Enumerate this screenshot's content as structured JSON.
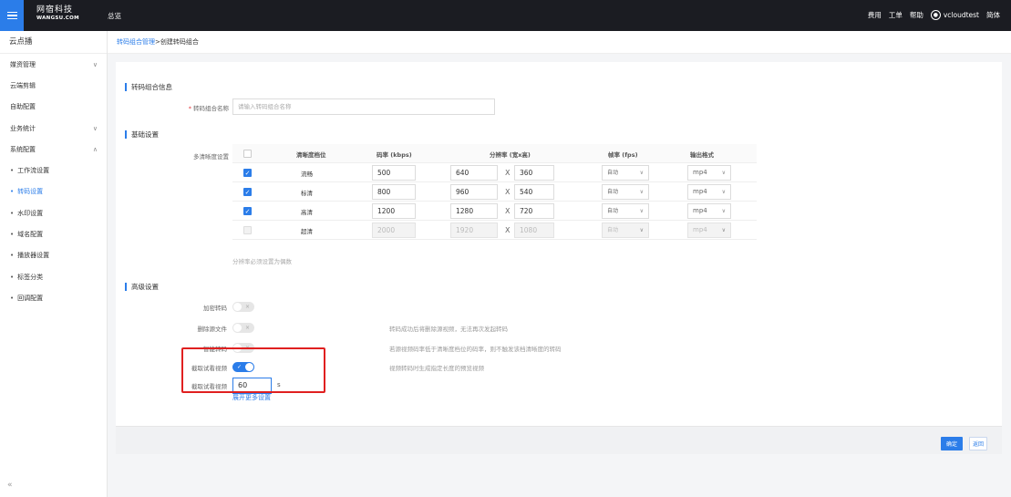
{
  "header": {
    "logo_cn": "网宿科技",
    "logo_en": "WANGSU.COM",
    "overview": "总览",
    "links": [
      "费用",
      "工单",
      "帮助"
    ],
    "username": "vcloudtest",
    "lang": "简体"
  },
  "sidebar": {
    "title": "云点播",
    "items": [
      {
        "label": "媒资管理",
        "chevron": "down"
      },
      {
        "label": "云端剪辑"
      },
      {
        "label": "自助配置"
      },
      {
        "label": "业务统计",
        "chevron": "down"
      },
      {
        "label": "系统配置",
        "chevron": "up"
      }
    ],
    "subitems": [
      "工作流设置",
      "转码设置",
      "水印设置",
      "域名配置",
      "播放器设置",
      "标签分类",
      "回调配置"
    ],
    "active_sub": "转码设置"
  },
  "breadcrumb": {
    "parent": "转码组合管理",
    "sep": ">",
    "current": "创建转码组合"
  },
  "group_info": {
    "title": "转码组合信息",
    "name_label": "转码组合名称",
    "name_placeholder": "请输入转码组合名称"
  },
  "basic": {
    "title": "基础设置",
    "multi_label": "多清晰度设置",
    "headers": {
      "level": "清晰度档位",
      "bitrate": "码率 (kbps)",
      "resolution": "分辨率 (宽x高)",
      "fps": "帧率 (fps)",
      "format": "输出格式"
    },
    "rows": [
      {
        "checked": true,
        "disabled": false,
        "level": "流畅",
        "bitrate": "500",
        "width": "640",
        "height": "360",
        "fps": "自动",
        "format": "mp4"
      },
      {
        "checked": true,
        "disabled": false,
        "level": "标清",
        "bitrate": "800",
        "width": "960",
        "height": "540",
        "fps": "自动",
        "format": "mp4"
      },
      {
        "checked": true,
        "disabled": false,
        "level": "高清",
        "bitrate": "1200",
        "width": "1280",
        "height": "720",
        "fps": "自动",
        "format": "mp4"
      },
      {
        "checked": false,
        "disabled": true,
        "level": "超清",
        "bitrate": "2000",
        "width": "1920",
        "height": "1080",
        "fps": "自动",
        "format": "mp4"
      }
    ],
    "x_sep": "X",
    "hint": "分辨率必须设置为偶数"
  },
  "advanced": {
    "title": "高级设置",
    "encrypt_label": "加密转码",
    "delete_label": "删除源文件",
    "delete_desc": "转码成功后将删除源视频，无法再次发起转码",
    "smart_label": "智能转码",
    "smart_desc": "若源视频码率低于清晰度档位的码率，则不触发该档清晰度的转码",
    "preview_label": "截取试看视频",
    "preview_desc": "视频转码时生成指定长度的预览视频",
    "preview_len_label": "截取试看视频",
    "preview_len_value": "60",
    "preview_unit": "s",
    "more_link": "展开更多设置"
  },
  "footer": {
    "confirm": "确定",
    "back": "返回"
  },
  "colors": {
    "accent": "#2b7de9",
    "topbar": "#1b1c22",
    "highlight": "#e02020"
  }
}
